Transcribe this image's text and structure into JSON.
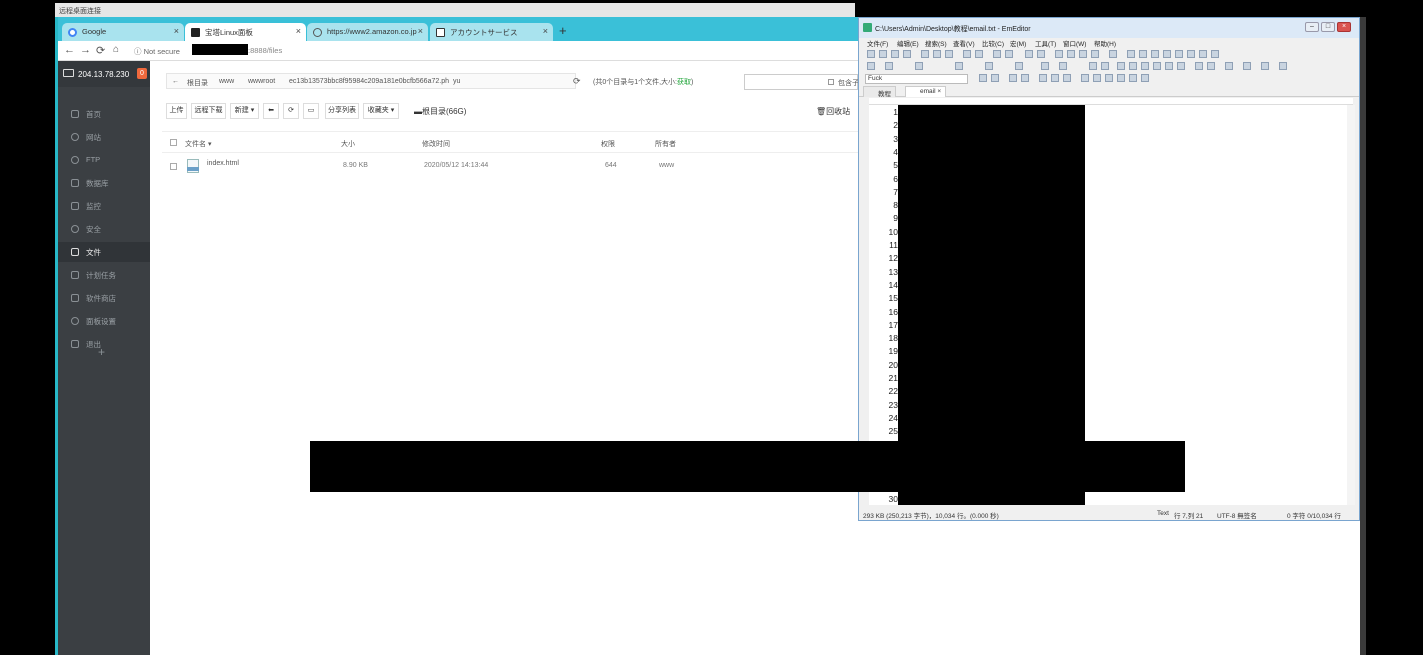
{
  "rdp_title": "远程桌面连接",
  "browser": {
    "tabs": [
      {
        "label": "Google"
      },
      {
        "label": "宝塔Linux面板"
      },
      {
        "label": "https://www2.amazon.co.jp"
      },
      {
        "label": "アカウントサービス"
      }
    ],
    "security_label": "Not secure",
    "url_suffix": ":8888/files"
  },
  "panel": {
    "server_ip": "204.13.78.230",
    "notice_count": "0",
    "menu": [
      "首页",
      "网站",
      "FTP",
      "数据库",
      "监控",
      "安全",
      "文件",
      "计划任务",
      "软件商店",
      "面板设置",
      "退出"
    ],
    "active_menu_index": 6,
    "add_label": "+"
  },
  "files": {
    "breadcrumb": [
      "根目录",
      "www",
      "wwwroot",
      "ec13b13573bbc8f95984c209a181e0bcfb566a72.ph",
      "yu"
    ],
    "summary_prefix": "(共0个目录与1个文件,大小:",
    "summary_link": "获取",
    "summary_suffix": ")",
    "subdir_label": "包含子目录",
    "toolbar": {
      "upload": "上传",
      "remote_download": "远程下载",
      "new": "新建",
      "back": "⬅",
      "refresh": "⟳",
      "terminal": "▭",
      "share_list": "分享列表",
      "favorites": "收藏夹",
      "root_dir": "根目录(66G)",
      "recycle_bin": "回收站"
    },
    "columns": [
      "文件名",
      "大小",
      "修改时间",
      "权限",
      "所有者"
    ],
    "rows": [
      {
        "name": "index.html",
        "size": "8.90 KB",
        "modified": "2020/05/12 14:13:44",
        "perm": "644",
        "owner": "www"
      }
    ]
  },
  "emeditor": {
    "title": "C:\\Users\\Admin\\Desktop\\教程\\email.txt - EmEditor",
    "menu": [
      "文件(F)",
      "编辑(E)",
      "搜索(S)",
      "查看(V)",
      "比较(C)",
      "宏(M)",
      "工具(T)",
      "窗口(W)",
      "帮助(H)"
    ],
    "font": "Fuck",
    "tabs": [
      "教程",
      "email"
    ],
    "line_numbers": [
      "1",
      "2",
      "3",
      "4",
      "5",
      "6",
      "7",
      "8",
      "9",
      "10",
      "11",
      "12",
      "13",
      "14",
      "15",
      "16",
      "17",
      "18",
      "19",
      "20",
      "21",
      "22",
      "23",
      "24",
      "25",
      "30"
    ],
    "status_left": "293 KB (250,213 字节)，10,034 行。(0.000 秒)",
    "status_mode": "Text",
    "status_pos": "行 7,列 21",
    "status_encoding": "UTF-8 無签名",
    "status_right": "0 字符  0/10,034 行"
  },
  "colors": {
    "tab_strip": "#3ac0d8",
    "sidebar": "#3b3f43",
    "badge": "#f0693d",
    "link_green": "#20a53a"
  }
}
